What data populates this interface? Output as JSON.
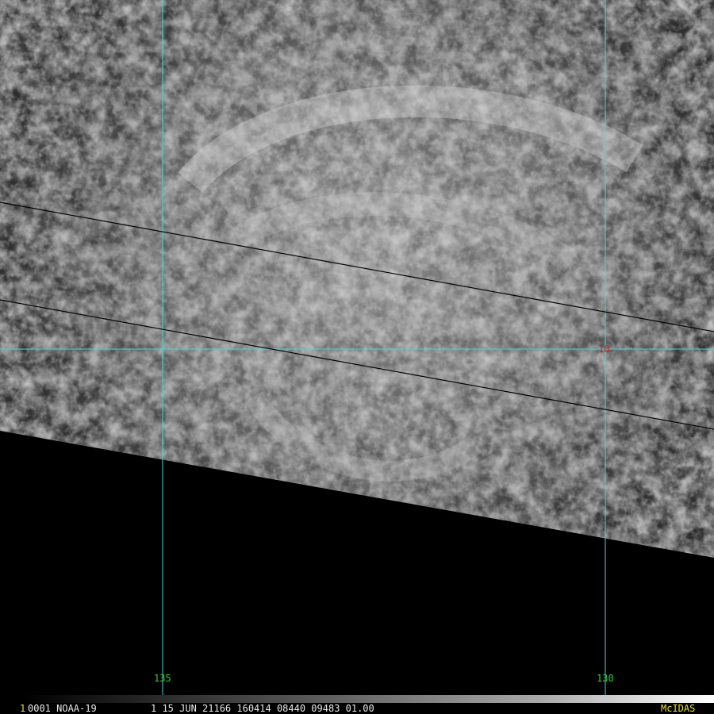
{
  "image": {
    "satellite_label": "0001 NOAA-19",
    "frame_index": "1",
    "status_text": "1 15 JUN 21166 160414 08440 09483 01.00",
    "logo": "McIDAS"
  },
  "grid": {
    "lon_labels": [
      "135",
      "130"
    ],
    "lat_labels": [
      "10"
    ]
  },
  "colors": {
    "grid_line": "#40d8d8",
    "lon_label": "#33cc33",
    "lat_label": "#cc2222",
    "status_text": "#e8e8e8",
    "logo": "#e8e020",
    "background": "#000000"
  }
}
